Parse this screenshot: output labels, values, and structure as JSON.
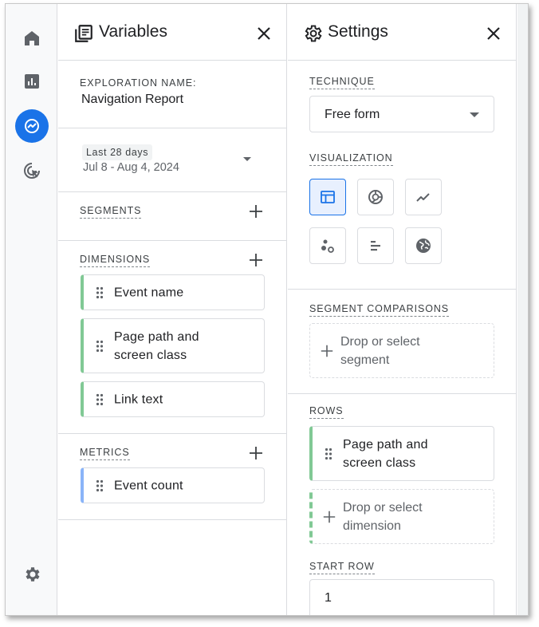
{
  "rail": {
    "items": [
      {
        "name": "home",
        "icon": "home-icon"
      },
      {
        "name": "reports",
        "icon": "bar-chart-icon"
      },
      {
        "name": "explore",
        "icon": "explore-icon",
        "active": true
      },
      {
        "name": "advertising",
        "icon": "cursor-target-icon"
      }
    ],
    "bottom_icon": "gear-icon"
  },
  "variables": {
    "title": "Variables",
    "exploration_name_label": "EXPLORATION NAME:",
    "exploration_name": "Navigation Report",
    "date_chip": "Last 28 days",
    "date_range": "Jul 8 - Aug 4, 2024",
    "segments_label": "SEGMENTS",
    "dimensions_label": "DIMENSIONS",
    "dimensions": [
      {
        "label": "Event name"
      },
      {
        "label": "Page path and\nscreen class"
      },
      {
        "label": "Link text"
      }
    ],
    "metrics_label": "METRICS",
    "metrics": [
      {
        "label": "Event count"
      }
    ]
  },
  "settings": {
    "title": "Settings",
    "technique_label": "TECHNIQUE",
    "technique_value": "Free form",
    "visualization_label": "VISUALIZATION",
    "visualizations": [
      {
        "icon": "table-icon",
        "selected": true
      },
      {
        "icon": "donut-chart-icon"
      },
      {
        "icon": "line-chart-icon"
      },
      {
        "icon": "scatter-plot-icon"
      },
      {
        "icon": "bar-chart-horizontal-icon"
      },
      {
        "icon": "globe-icon"
      }
    ],
    "segment_comparisons_label": "SEGMENT COMPARISONS",
    "segment_drop": "Drop or select\nsegment",
    "rows_label": "ROWS",
    "rows": [
      {
        "label": "Page path and\nscreen class"
      }
    ],
    "dimension_drop": "Drop or select\ndimension",
    "start_row_label": "START ROW",
    "start_row_value": "1"
  },
  "colors": {
    "accent": "#1a73e8",
    "dimension_bar": "#81c995",
    "metric_bar": "#8ab4f8",
    "icon_gray": "#5f6368"
  }
}
